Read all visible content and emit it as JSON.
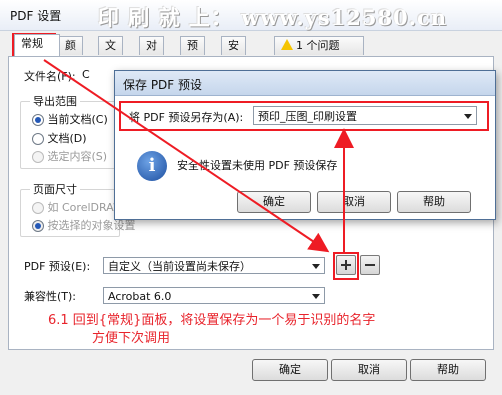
{
  "window": {
    "title": "PDF 设置",
    "watermark": "印 刷 就 上： www.ys12580.cn"
  },
  "tabs": [
    "常规",
    "颜色",
    "文档",
    "对象",
    "预印",
    "安全性",
    "1 个问题"
  ],
  "general": {
    "filename_label": "文件名(F):",
    "filename_value": "C",
    "export_range": {
      "legend": "导出范围",
      "current_doc": "当前文档(C)",
      "document": "文档(D)",
      "selected": "选定内容(S)"
    },
    "page_size": {
      "legend": "页面尺寸",
      "as_coreldraw": "如 CorelDRAW",
      "selected_object": "按选择的对象设置"
    },
    "pdf_preset_label": "PDF 预设(E):",
    "pdf_preset_value": "自定义（当前设置尚未保存）",
    "compat_label": "兼容性(T):",
    "compat_value": "Acrobat 6.0"
  },
  "annotation": {
    "line1": "6.1 回到{常规}面板，将设置保存为一个易于识别的名字",
    "line2": "方便下次调用",
    "color": "#e8242c"
  },
  "bottom_buttons": {
    "ok": "确定",
    "cancel": "取消",
    "help": "帮助"
  },
  "save_dialog": {
    "title": "保存 PDF 预设",
    "save_as_label": "将 PDF 预设另存为(A):",
    "save_as_value": "预印_压图_印刷设置",
    "message": "安全性设置未使用 PDF 预设保存",
    "ok": "确定",
    "cancel": "取消",
    "help": "帮助"
  }
}
